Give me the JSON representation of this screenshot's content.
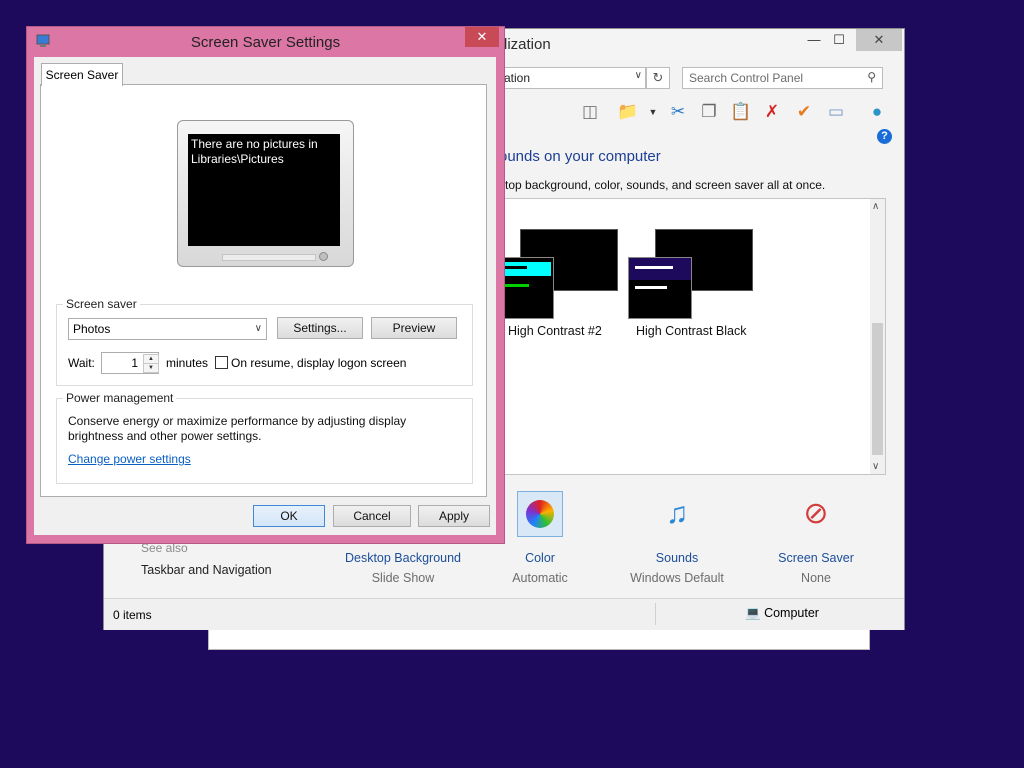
{
  "personalization": {
    "title_visible": "lization",
    "address_text": "ation",
    "search_placeholder": "Search Control Panel",
    "heading": "ounds on your computer",
    "description": "ktop background, color, sounds, and screen saver all at once.",
    "themes": [
      {
        "name": "High Contrast #2"
      },
      {
        "name": "High Contrast Black"
      }
    ],
    "see_also_label": "See also",
    "see_also_links": [
      "Taskbar and Navigation"
    ],
    "bottom_items": [
      {
        "label": "Desktop Background",
        "sublabel": "Slide Show",
        "icon": "desktop-background-icon"
      },
      {
        "label": "Color",
        "sublabel": "Automatic",
        "icon": "color-icon"
      },
      {
        "label": "Sounds",
        "sublabel": "Windows Default",
        "icon": "sounds-icon"
      },
      {
        "label": "Screen Saver",
        "sublabel": "None",
        "icon": "screen-saver-icon"
      }
    ],
    "status_items": "0 items",
    "status_location": "Computer"
  },
  "dialog": {
    "title": "Screen Saver Settings",
    "tab_label": "Screen Saver",
    "preview_text": "There are no pictures in Libraries\\Pictures",
    "screen_saver_group_label": "Screen saver",
    "screen_saver_value": "Photos",
    "settings_button": "Settings...",
    "preview_button": "Preview",
    "wait_label": "Wait:",
    "wait_value": "1",
    "minutes_label": "minutes",
    "resume_label": "On resume, display logon screen",
    "resume_checked": false,
    "power_group_label": "Power management",
    "power_description": "Conserve energy or maximize performance by adjusting display brightness and other power settings.",
    "power_link": "Change power settings",
    "ok_button": "OK",
    "cancel_button": "Cancel",
    "apply_button": "Apply"
  },
  "colors": {
    "desktop": "#1e0a5c",
    "dialog_frame": "#dc76a5",
    "close_button": "#c74a56",
    "link": "#0a5fc4",
    "heading": "#1c3f94"
  }
}
